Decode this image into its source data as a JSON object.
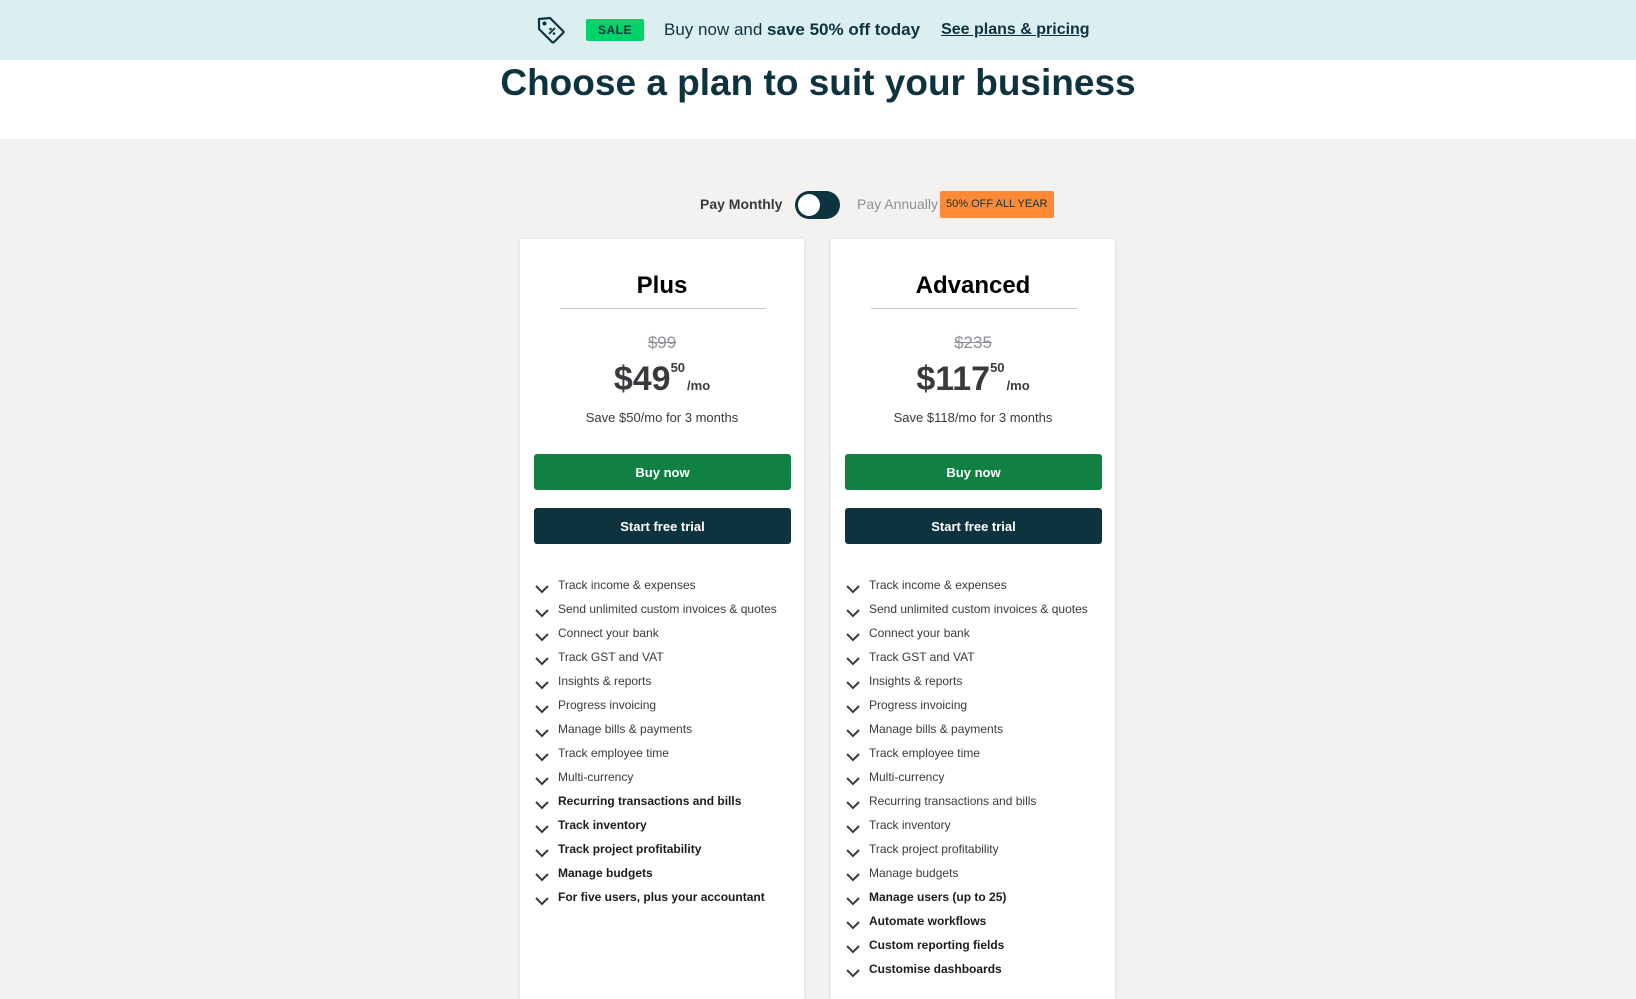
{
  "banner": {
    "icon": "price-tag-icon",
    "sale_label": "SALE",
    "text_prefix": "Buy now and ",
    "text_bold": "save 50% off today",
    "link": "See plans & pricing"
  },
  "page": {
    "title": "Choose a plan to suit your business"
  },
  "billing": {
    "monthly_label": "Pay Monthly",
    "annually_label": "Pay Annually",
    "discount_badge": "50% OFF ALL YEAR",
    "toggle_state": "monthly"
  },
  "plans": [
    {
      "name": "Plus",
      "old_price": "$99",
      "price_main": "$49",
      "price_cents": "50",
      "price_period": "/mo",
      "save_note": "Save $50/mo for 3 months",
      "buy_label": "Buy now",
      "trial_label": "Start free trial",
      "features": [
        {
          "text": "Track income & expenses",
          "bold": false
        },
        {
          "text": "Send unlimited custom invoices & quotes",
          "bold": false
        },
        {
          "text": "Connect your bank",
          "bold": false
        },
        {
          "text": "Track GST and VAT",
          "bold": false
        },
        {
          "text": "Insights & reports",
          "bold": false
        },
        {
          "text": "Progress invoicing",
          "bold": false
        },
        {
          "text": "Manage bills & payments",
          "bold": false
        },
        {
          "text": "Track employee time",
          "bold": false
        },
        {
          "text": "Multi-currency",
          "bold": false
        },
        {
          "text": "Recurring transactions and bills",
          "bold": true
        },
        {
          "text": "Track inventory",
          "bold": true
        },
        {
          "text": "Track project profitability",
          "bold": true
        },
        {
          "text": "Manage budgets",
          "bold": true
        },
        {
          "text": "For five users, plus your accountant",
          "bold": true
        }
      ]
    },
    {
      "name": "Advanced",
      "old_price": "$235",
      "price_main": "$117",
      "price_cents": "50",
      "price_period": "/mo",
      "save_note": "Save $118/mo for 3 months",
      "buy_label": "Buy now",
      "trial_label": "Start free trial",
      "features": [
        {
          "text": "Track income & expenses",
          "bold": false
        },
        {
          "text": "Send unlimited custom invoices & quotes",
          "bold": false
        },
        {
          "text": "Connect your bank",
          "bold": false
        },
        {
          "text": "Track GST and VAT",
          "bold": false
        },
        {
          "text": "Insights & reports",
          "bold": false
        },
        {
          "text": "Progress invoicing",
          "bold": false
        },
        {
          "text": "Manage bills & payments",
          "bold": false
        },
        {
          "text": "Track employee time",
          "bold": false
        },
        {
          "text": "Multi-currency",
          "bold": false
        },
        {
          "text": "Recurring transactions and bills",
          "bold": false
        },
        {
          "text": "Track inventory",
          "bold": false
        },
        {
          "text": "Track project profitability",
          "bold": false
        },
        {
          "text": "Manage budgets",
          "bold": false
        },
        {
          "text": "Manage users (up to 25)",
          "bold": true
        },
        {
          "text": "Automate workflows",
          "bold": true
        },
        {
          "text": "Custom reporting fields",
          "bold": true
        },
        {
          "text": "Customise dashboards",
          "bold": true
        }
      ]
    }
  ],
  "colors": {
    "brand_green": "#108043",
    "sale_green": "#00d36a",
    "dark_navy": "#0d333f",
    "discount_orange": "#ff8a36",
    "banner_bg": "#dbeef0",
    "page_bg": "#f3f2f1"
  }
}
